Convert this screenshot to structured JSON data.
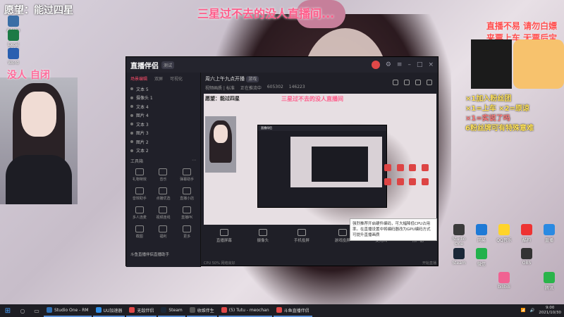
{
  "overlay": {
    "top_left": "愿望：能过四星",
    "top_center": "三星过不去的没人直播间...",
    "cam_caption": "没人 自闭",
    "right_note": "直播不易 请勿白嫖\n来票上车 无票后宝",
    "rules": [
      "×1加入粉丝团",
      "×1=上车  ×2=原谅",
      "×1=实说了吗",
      "6粉丝牌可有特殊意难"
    ]
  },
  "desktop_icons": [
    {
      "label": "Adobe",
      "color": "#3a6ea5"
    },
    {
      "label": "Excel 2016",
      "color": "#1d7a45"
    },
    {
      "label": "Word",
      "color": "#2a5fb0"
    }
  ],
  "desktop_icons_right": [
    {
      "label": "Studio One",
      "color": "#3b3b3b"
    },
    {
      "label": "网易",
      "color": "#1f7ad6"
    },
    {
      "label": "QQ音乐",
      "color": "#ffd42a"
    },
    {
      "label": "酷狗",
      "color": "#e33"
    },
    {
      "label": "直播",
      "color": "#2a8ae2"
    },
    {
      "label": "Steam",
      "color": "#1b2838"
    },
    {
      "label": "微信",
      "color": "#22b14c"
    },
    {
      "label": "OBS",
      "color": "#333"
    },
    {
      "label": "bilibili",
      "color": "#f06292"
    },
    {
      "label": "腾讯",
      "color": "#2ab44a"
    }
  ],
  "app": {
    "name": "直播伴侣",
    "version_badge": "测试",
    "tabs": [
      "场景编辑",
      "双屏",
      "可视化"
    ],
    "sources": [
      "文本 5",
      "摄像头 1",
      "文本 4",
      "图片 4",
      "文本 3",
      "图片 3",
      "图片 2",
      "文本 2"
    ],
    "tools_label": "工具箱",
    "tools": [
      "礼物特效",
      "音乐",
      "弹幕助手",
      "音效助手",
      "点播优选",
      "直播小店",
      "多人连麦",
      "视频连线",
      "直播PK",
      "截图",
      "福利",
      "更多"
    ],
    "bottom_note": "斗鱼直播伴侣直播助手",
    "stream_title": "周六上午九点开播",
    "stream_badge": "游戏",
    "stream_meta": [
      "视频画质 | 标准",
      "正在推流中",
      "605302",
      "146223"
    ],
    "preview_title": "三星过不去的没人直播间",
    "preview_left": "愿望：能过四星",
    "controls": [
      "直播屏幕",
      "摄像头",
      "手机投屏",
      "游戏投屏",
      "麦克风",
      "扬声器"
    ],
    "status_left": "CPU 50%  网络良好",
    "status_right": "开始直播",
    "tooltip": "强烈推荐开启硬件编码，可大幅降低CPU占用率。在直播设置中将编码器改为GPU编码方式可提升直播画质"
  },
  "taskbar": {
    "start_icon": "windows-icon",
    "tasks": [
      {
        "label": "Studio One - RM",
        "color": "#2f6fb3"
      },
      {
        "label": "UU加速器",
        "color": "#2f8de4"
      },
      {
        "label": "无敌伴侣",
        "color": "#e04848"
      },
      {
        "label": "Steam",
        "color": "#1b2838"
      },
      {
        "label": "收维伴生",
        "color": "#555"
      },
      {
        "label": "(5) Tutu - meochan",
        "color": "#e04848"
      },
      {
        "label": "斗鱼直播伴侣",
        "color": "#e04848"
      }
    ],
    "time": "9:00",
    "date": "2021/10/30"
  }
}
